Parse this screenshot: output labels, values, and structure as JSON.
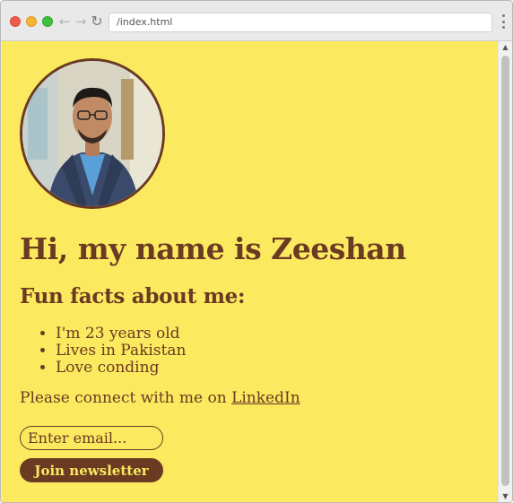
{
  "browser": {
    "url": "/index.html",
    "back_icon": "←",
    "forward_icon": "→",
    "reload_icon": "↻"
  },
  "page": {
    "heading": "Hi, my name is Zeeshan",
    "subheading": "Fun facts about me:",
    "facts": [
      "I'm 23 years old",
      "Lives in Pakistan",
      "Love conding"
    ],
    "connect_prefix": "Please connect with me on ",
    "connect_link": "LinkedIn",
    "email_placeholder": "Enter email...",
    "join_button": "Join newsletter"
  },
  "colors": {
    "background": "#fbe95f",
    "text": "#6a3a22",
    "button_text": "#fbe95f"
  },
  "icons": {
    "avatar": "profile-photo",
    "scroll_up": "▲",
    "scroll_down": "▼"
  }
}
